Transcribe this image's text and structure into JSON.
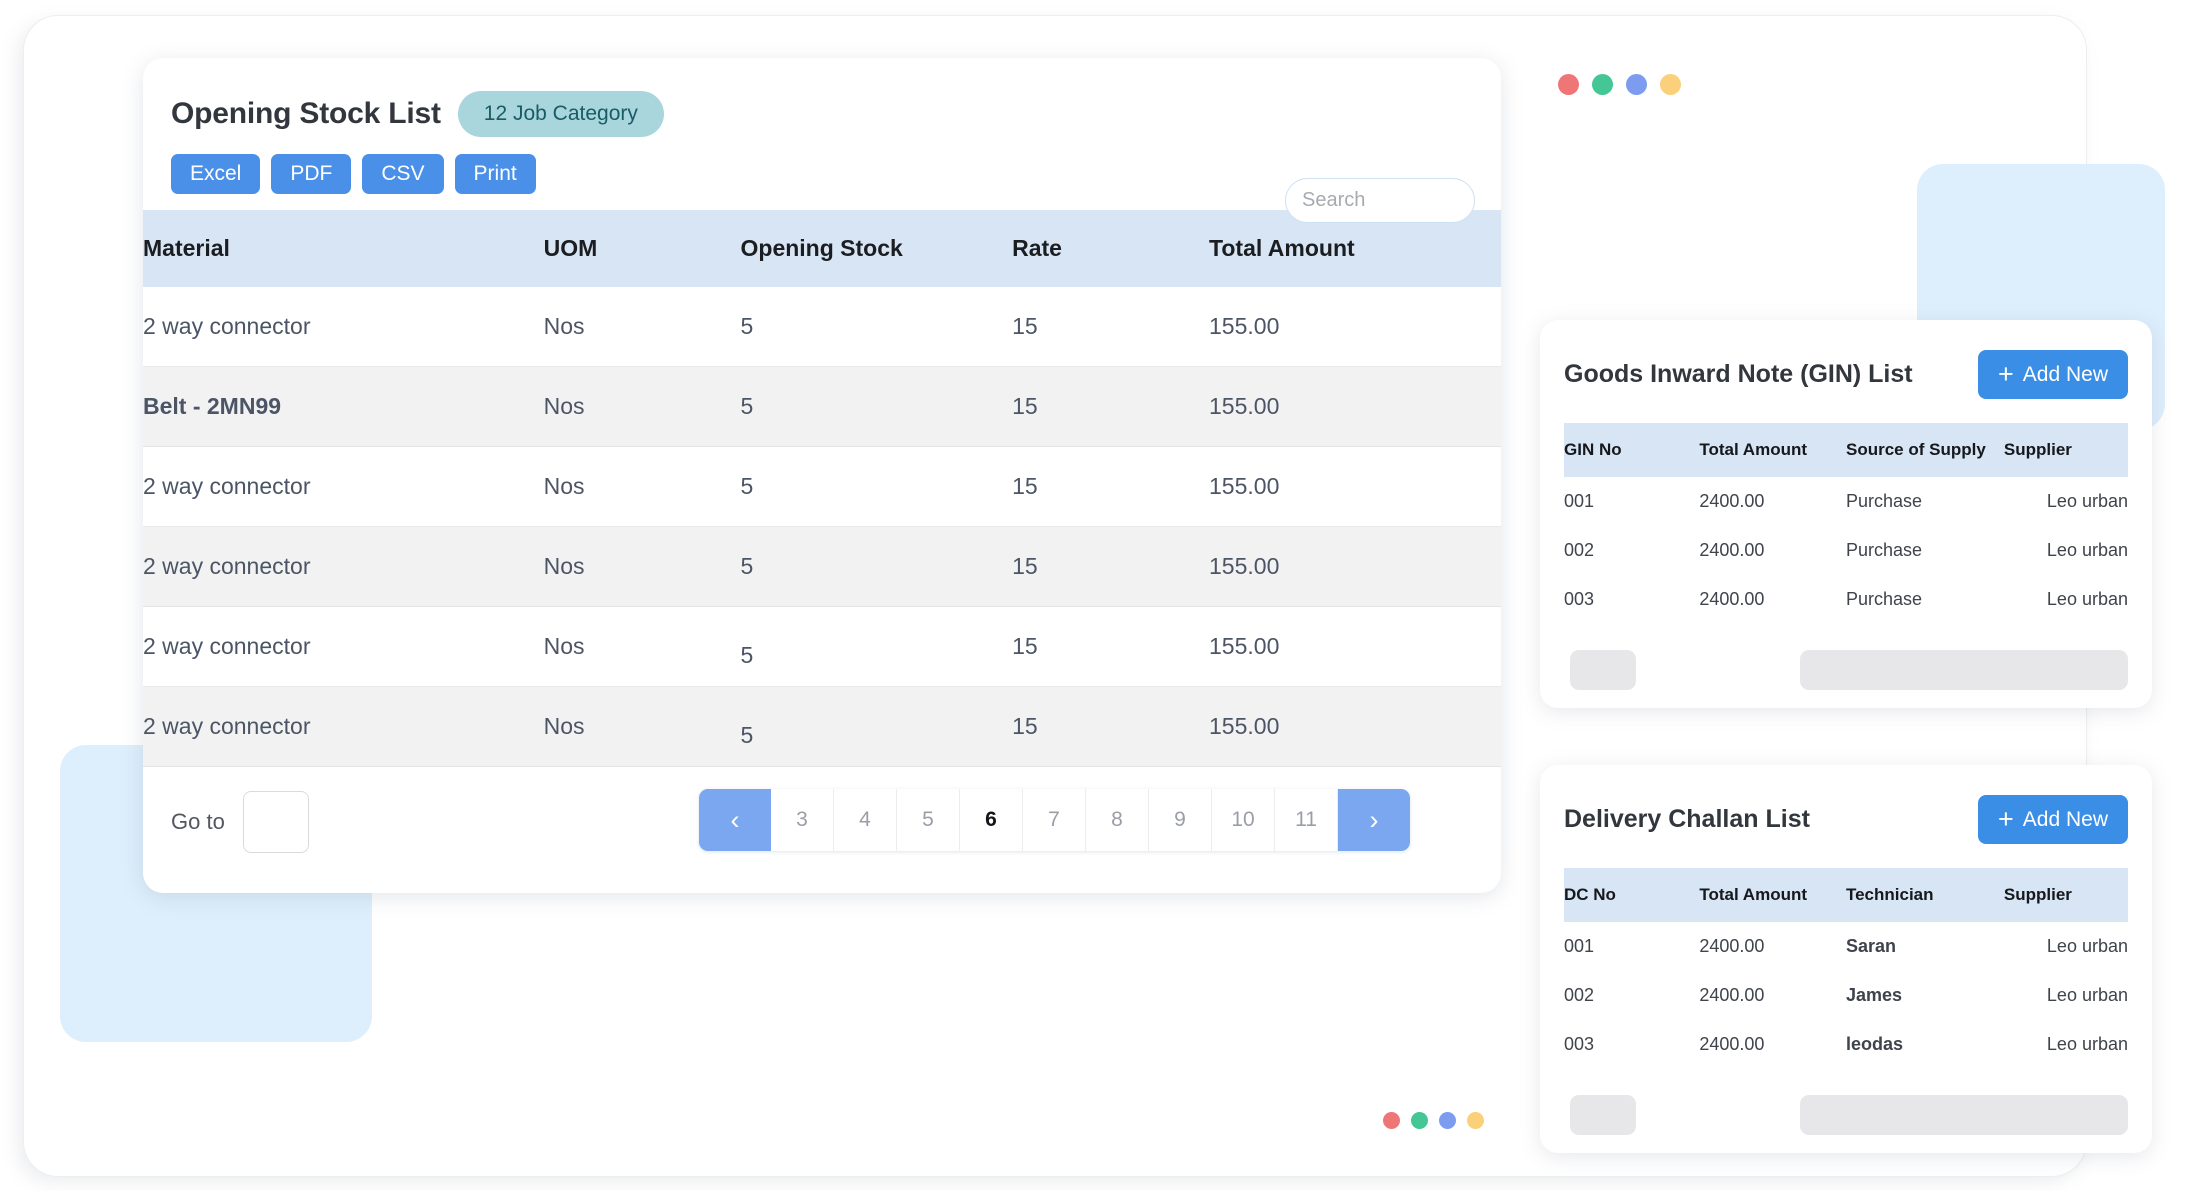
{
  "stock_card": {
    "title": "Opening Stock List",
    "badge": "12 Job Category",
    "export_buttons": [
      "Excel",
      "PDF",
      "CSV",
      "Print"
    ],
    "search": {
      "placeholder": "Search",
      "value": "",
      "icon": "search-icon"
    },
    "columns": [
      "Material",
      "UOM",
      "Opening Stock",
      "Rate",
      "Total Amount"
    ],
    "rows": [
      {
        "material": "2 way connector",
        "uom": "Nos",
        "opening_stock": "5",
        "rate": "15",
        "total_amount": "155.00",
        "bold": false,
        "alt": false,
        "drop": false
      },
      {
        "material": "Belt - 2MN99",
        "uom": "Nos",
        "opening_stock": "5",
        "rate": "15",
        "total_amount": "155.00",
        "bold": true,
        "alt": true,
        "drop": false
      },
      {
        "material": "2 way connector",
        "uom": "Nos",
        "opening_stock": "5",
        "rate": "15",
        "total_amount": "155.00",
        "bold": false,
        "alt": false,
        "drop": false
      },
      {
        "material": "2 way connector",
        "uom": "Nos",
        "opening_stock": "5",
        "rate": "15",
        "total_amount": "155.00",
        "bold": false,
        "alt": true,
        "drop": false
      },
      {
        "material": "2 way connector",
        "uom": "Nos",
        "opening_stock": "5",
        "rate": "15",
        "total_amount": "155.00",
        "bold": false,
        "alt": false,
        "drop": true
      },
      {
        "material": "2 way connector",
        "uom": "Nos",
        "opening_stock": "5",
        "rate": "15",
        "total_amount": "155.00",
        "bold": false,
        "alt": true,
        "drop": true
      }
    ],
    "pagination": {
      "goto_label": "Go to",
      "goto_value": "",
      "prev_icon": "chevron-left-icon",
      "next_icon": "chevron-right-icon",
      "pages": [
        "3",
        "4",
        "5",
        "6",
        "7",
        "8",
        "9",
        "10",
        "11"
      ],
      "active_page": "6"
    }
  },
  "gin_card": {
    "title": "Goods Inward Note (GIN) List",
    "add_new_label": "Add New",
    "columns": [
      "GIN No",
      "Total Amount",
      "Source of Supply",
      "Supplier"
    ],
    "rows": [
      {
        "no": "001",
        "amount": "2400.00",
        "source": "Purchase",
        "supplier": "Leo urban"
      },
      {
        "no": "002",
        "amount": "2400.00",
        "source": "Purchase",
        "supplier": "Leo urban"
      },
      {
        "no": "003",
        "amount": "2400.00",
        "source": "Purchase",
        "supplier": "Leo urban"
      }
    ]
  },
  "dc_card": {
    "title": "Delivery Challan List",
    "add_new_label": "Add New",
    "columns": [
      "DC No",
      "Total Amount",
      "Technician",
      "Supplier"
    ],
    "rows": [
      {
        "no": "001",
        "amount": "2400.00",
        "technician": "Saran",
        "supplier": "Leo urban"
      },
      {
        "no": "002",
        "amount": "2400.00",
        "technician": "James",
        "supplier": "Leo urban"
      },
      {
        "no": "003",
        "amount": "2400.00",
        "technician": "leodas",
        "supplier": "Leo urban"
      }
    ]
  },
  "decor": {
    "dot_colors": [
      "#ef7676",
      "#45c795",
      "#7d9cf0",
      "#fbd07a"
    ],
    "square_color": "#ddeefc",
    "accent_blue": "#4a90e8",
    "badge_bg": "#a9d5dc",
    "badge_text": "#195c66",
    "table_header_bg": "#d7e5f5"
  }
}
